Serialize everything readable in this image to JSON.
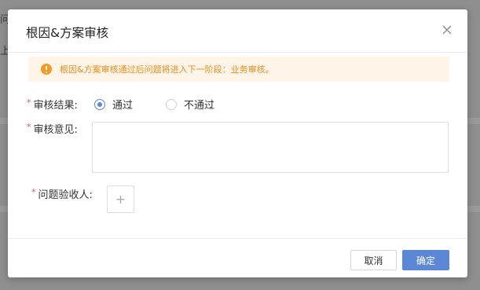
{
  "background": {
    "fragment_1": "问",
    "fragment_2": "上"
  },
  "dialog": {
    "title": "根因&方案审核",
    "alert": "根因&方案审核通过后问题将进入下一阶段：业务审核。",
    "required_mark": "*",
    "review_result": {
      "label": "审核结果:",
      "options": [
        "通过",
        "不通过"
      ],
      "selected": "通过"
    },
    "review_opinion": {
      "label": "审核意见:",
      "value": ""
    },
    "acceptor": {
      "label": "问题验收人:",
      "add_symbol": "+"
    },
    "buttons": {
      "cancel": "取消",
      "confirm": "确定"
    }
  },
  "colors": {
    "primary": "#5b87d6",
    "warning": "#f59a23",
    "warning_bg": "#fff4e8",
    "required": "#e45454"
  }
}
